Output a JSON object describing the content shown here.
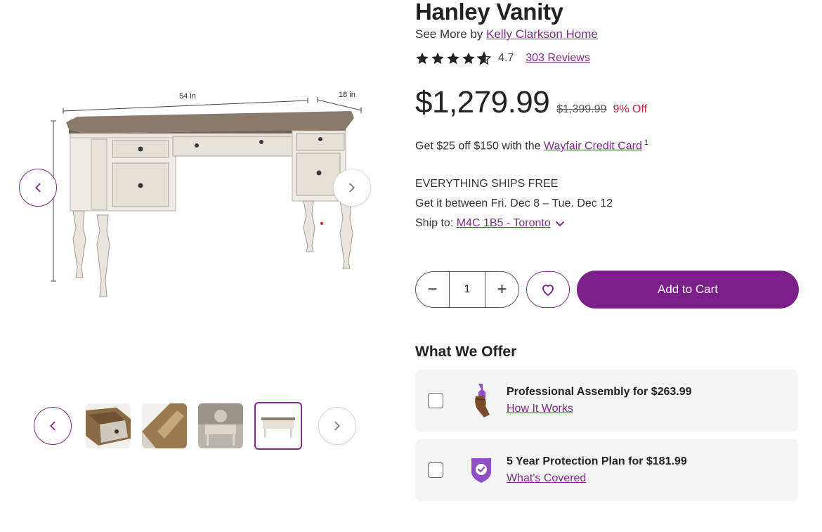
{
  "product": {
    "title": "Hanley Vanity",
    "brand_prefix": "See More by",
    "brand_name": "Kelly Clarkson Home",
    "rating": "4.7",
    "rating_stars": 4.7,
    "reviews_label": "303 Reviews"
  },
  "image": {
    "dim_width": "54 in",
    "dim_depth": "18 in"
  },
  "pricing": {
    "price": "$1,279.99",
    "old_price": "$1,399.99",
    "discount": "9% Off"
  },
  "credit": {
    "text": "Get $25 off $150 with the",
    "link": "Wayfair Credit Card",
    "footnote": "1"
  },
  "shipping": {
    "free_label": "EVERYTHING SHIPS FREE",
    "delivery": "Get it between Fri. Dec 8 – Tue. Dec 12",
    "ship_to_label": "Ship to:",
    "ship_to_location": "M4C 1B5 - Toronto"
  },
  "cart": {
    "quantity": "1",
    "minus": "−",
    "plus": "+",
    "add_label": "Add to Cart"
  },
  "offers": {
    "title": "What We Offer",
    "items": [
      {
        "label": "Professional Assembly for $263.99",
        "link": "How It Works",
        "icon": "wrench-hand-icon"
      },
      {
        "label": "5 Year Protection Plan for $181.99",
        "link": "What's Covered",
        "icon": "shield-check-icon"
      }
    ]
  },
  "colors": {
    "accent": "#7b2d83",
    "cta": "#7b1f88",
    "discount": "#b12a3c",
    "card_bg": "#f4f4f4"
  }
}
